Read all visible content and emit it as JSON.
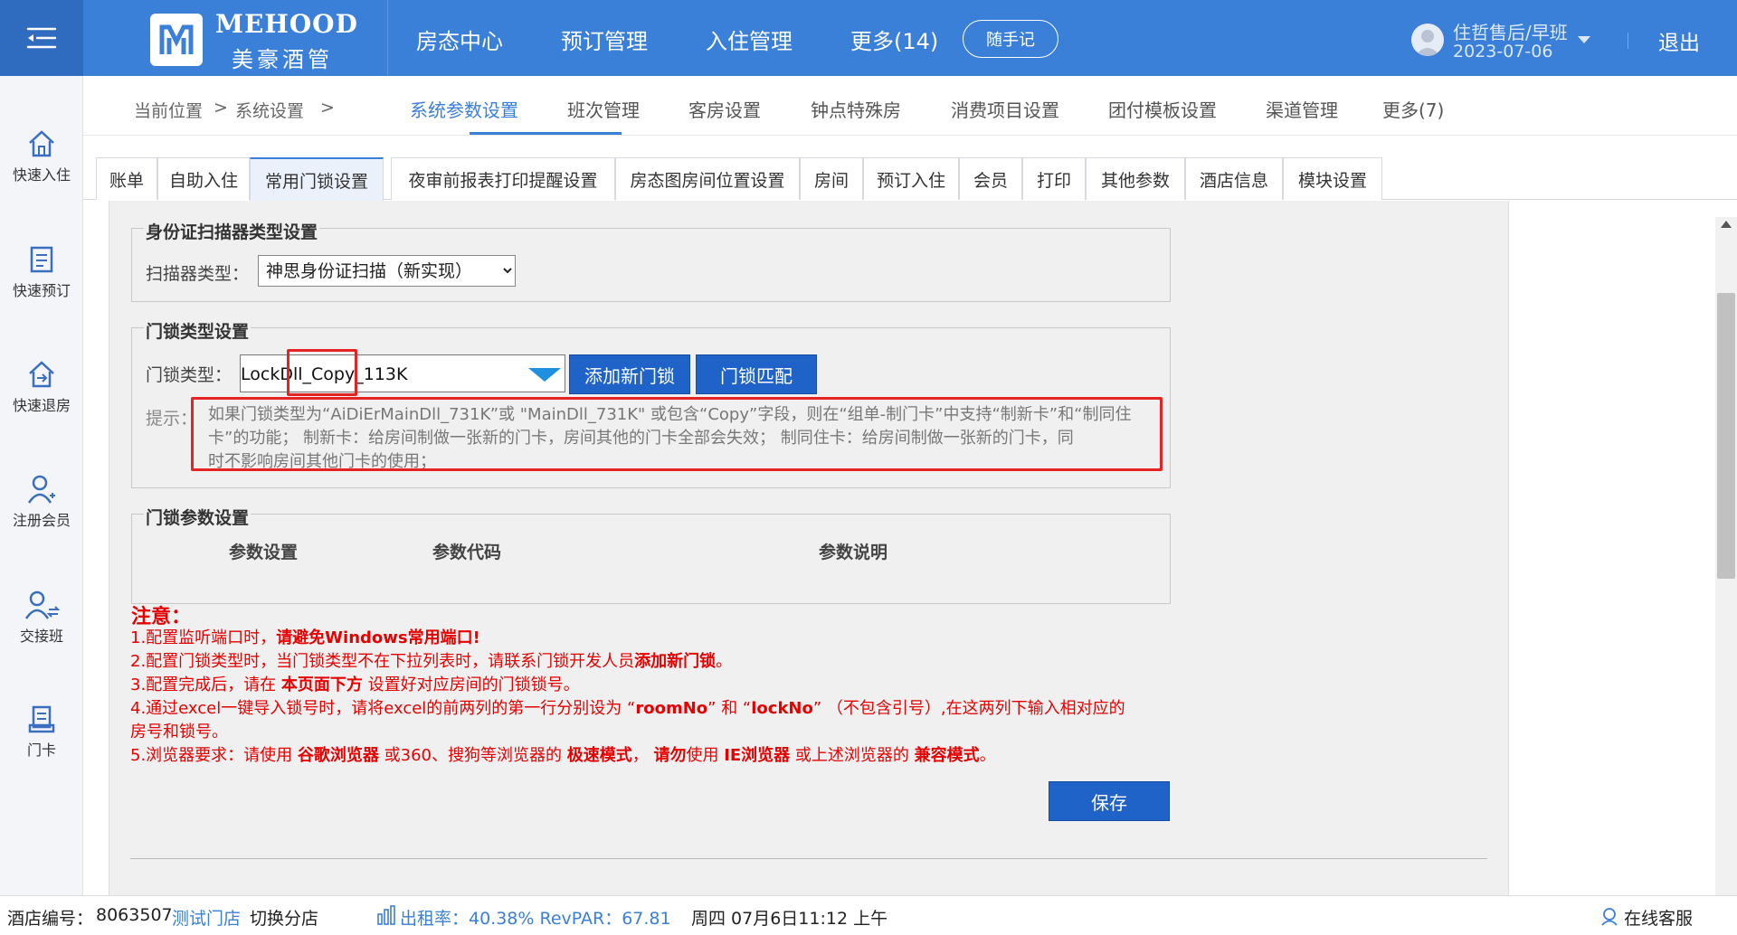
{
  "brand": {
    "name_en": "MEHOOD",
    "name_cn": "美豪酒管"
  },
  "topnav": {
    "items": [
      "房态中心",
      "预订管理",
      "入住管理",
      "更多(14)"
    ],
    "memo": "随手记",
    "user_name": "住哲售后/早班",
    "user_date": "2023-07-06",
    "logout": "退出"
  },
  "sidebar": {
    "items": [
      "快速入住",
      "快速预订",
      "快速退房",
      "注册会员",
      "交接班",
      "门卡"
    ]
  },
  "breadcrumb": {
    "label": "当前位置",
    "sep": ">",
    "section": "系统设置",
    "sep2": ">"
  },
  "subnav": {
    "items": [
      "系统参数设置",
      "班次管理",
      "客房设置",
      "钟点特殊房",
      "消费项目设置",
      "团付模板设置",
      "渠道管理",
      "更多(7)"
    ],
    "active": "系统参数设置"
  },
  "tabs": {
    "items": [
      "账单",
      "自助入住",
      "常用门锁设置",
      "夜审前报表打印提醒设置",
      "房态图房间位置设置",
      "房间",
      "预订入住",
      "会员",
      "打印",
      "其他参数",
      "酒店信息",
      "模块设置"
    ],
    "active": "常用门锁设置"
  },
  "scanner": {
    "legend": "身份证扫描器类型设置",
    "label": "扫描器类型：",
    "value": "神思身份证扫描（新实现）"
  },
  "lock": {
    "legend": "门锁类型设置",
    "label": "门锁类型：",
    "value": "LockDll_Copy_113K",
    "add_button": "添加新门锁",
    "match_button": "门锁匹配",
    "hint_label": "提示：",
    "hint_lines": [
      "如果门锁类型为“AiDiErMainDll_731K”或 \"MainDll_731K\" 或包含“Copy”字段，则在“组单-制门卡”中支持“制新卡”和“制同住",
      "卡”的功能； 制新卡：给房间制做一张新的门卡，房间其他的门卡全部会失效； 制同住卡：给房间制做一张新的门卡，同",
      "时不影响房间其他门卡的使用；"
    ]
  },
  "params": {
    "legend": "门锁参数设置",
    "columns": [
      "参数设置",
      "参数代码",
      "参数说明"
    ]
  },
  "notice": {
    "title": "注意：",
    "line1_a": "1.配置监听端口时，",
    "line1_b": "请避免Windows常用端口!",
    "line2_a": "2.配置门锁类型时，当门锁类型不在下拉列表时，请联系门锁开发人员",
    "line2_b": "添加新门锁",
    "line2_c": "。",
    "line3_a": "3.配置完成后，请在 ",
    "line3_b": "本页面下方",
    "line3_c": " 设置好对应房间的门锁锁号。",
    "line4_a": "4.通过excel一键导入锁号时，请将excel的前两列的第一行分别设为 “",
    "line4_b": "roomNo",
    "line4_c": "” 和 “",
    "line4_d": "lockNo",
    "line4_e": "” （不包含引号）,在这两列下输入相对应的",
    "line4_f": "房号和锁号。",
    "line5_a": "5.浏览器要求：请使用 ",
    "line5_b": "谷歌浏览器",
    "line5_c": " 或360、搜狗等浏览器的 ",
    "line5_d": "极速模式",
    "line5_e": "， ",
    "line5_f": "请勿",
    "line5_g": "使用 ",
    "line5_h": "IE浏览器",
    "line5_i": " 或上述浏览器的 ",
    "line5_j": "兼容模式",
    "line5_k": "。"
  },
  "save_button": "保存",
  "status": {
    "hotel_label": "酒店编号：",
    "hotel_id": "8063507",
    "store": "测试门店",
    "switch": "切换分店",
    "occupancy": "出租率：40.38% RevPAR：67.81",
    "datetime": "周四 07月6日11:12 上午",
    "service": "在线客服"
  },
  "colors": {
    "primary": "#3a7fd8",
    "button": "#1f63c8",
    "alert": "#e60000",
    "highlight_box": "#e62222"
  }
}
